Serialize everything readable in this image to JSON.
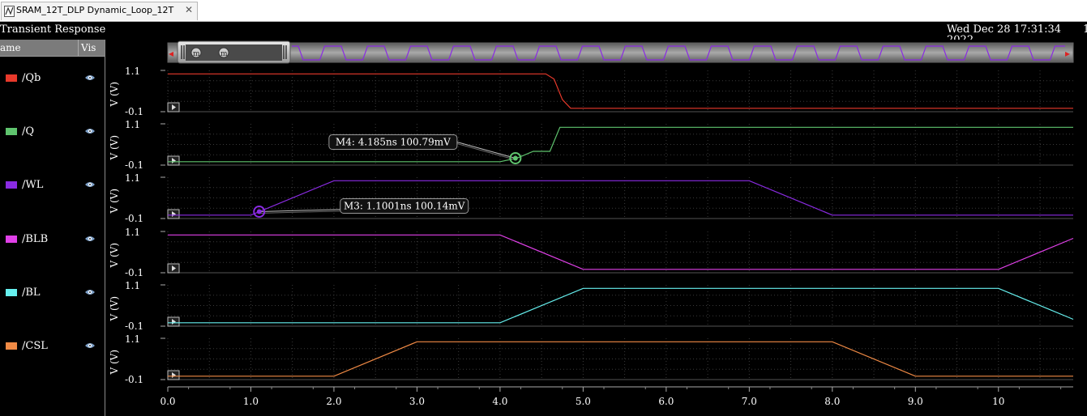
{
  "window": {
    "tab_title": "SRAM_12T_DLP Dynamic_Loop_12T ...",
    "close_glyph": "✕",
    "icon": "waveform-icon"
  },
  "header": {
    "title": "Transient Response",
    "timestamp": "Wed Dec 28 17:31:34",
    "timestamp_line2": "2022",
    "edge_char": "1"
  },
  "legend": {
    "col_name": "ame",
    "col_vis": "Vis",
    "visibility_icon": "eye-icon",
    "signals": [
      {
        "name": "/Qb",
        "color": "#e8392b"
      },
      {
        "name": "/Q",
        "color": "#5fc46e"
      },
      {
        "name": "/WL",
        "color": "#8a2be2"
      },
      {
        "name": "/BLB",
        "color": "#e040e8"
      },
      {
        "name": "/BL",
        "color": "#66f0ef"
      },
      {
        "name": "/CSL",
        "color": "#f08a45"
      }
    ]
  },
  "chart_data": {
    "type": "line",
    "xlim": [
      0,
      10.9
    ],
    "x_ticks": [
      "0.0",
      "1.0",
      "2.0",
      "3.0",
      "4.0",
      "5.0",
      "6.0",
      "7.0",
      "8.0",
      "9.0",
      "10"
    ],
    "ylim": [
      -0.1,
      1.1
    ],
    "y_tick_labels": [
      "1.1",
      "-0.1"
    ],
    "ylabel": "V (V)",
    "grid": true,
    "series": [
      {
        "name": "/Qb",
        "color": "#e8392b",
        "points": [
          [
            0,
            1.0
          ],
          [
            4.55,
            1.0
          ],
          [
            4.65,
            0.85
          ],
          [
            4.75,
            0.25
          ],
          [
            4.85,
            0.0
          ],
          [
            10.9,
            0.0
          ]
        ]
      },
      {
        "name": "/Q",
        "color": "#5fc46e",
        "points": [
          [
            0,
            0.0
          ],
          [
            4.0,
            0.0
          ],
          [
            4.2,
            0.1
          ],
          [
            4.4,
            0.3
          ],
          [
            4.6,
            0.3
          ],
          [
            4.72,
            1.0
          ],
          [
            10.9,
            1.0
          ]
        ]
      },
      {
        "name": "/WL",
        "color": "#8a2be2",
        "points": [
          [
            0,
            0.0
          ],
          [
            1.0,
            0.0
          ],
          [
            2.0,
            1.0
          ],
          [
            7.0,
            1.0
          ],
          [
            8.0,
            0.0
          ],
          [
            10.9,
            0.0
          ]
        ]
      },
      {
        "name": "/BLB",
        "color": "#e040e8",
        "points": [
          [
            0,
            1.0
          ],
          [
            4.0,
            1.0
          ],
          [
            5.0,
            0.0
          ],
          [
            10.0,
            0.0
          ],
          [
            10.9,
            0.9
          ]
        ]
      },
      {
        "name": "/BL",
        "color": "#66f0ef",
        "points": [
          [
            0,
            0.0
          ],
          [
            4.0,
            0.0
          ],
          [
            5.0,
            1.0
          ],
          [
            10.0,
            1.0
          ],
          [
            10.9,
            0.1
          ]
        ]
      },
      {
        "name": "/CSL",
        "color": "#f08a45",
        "points": [
          [
            0,
            0.0
          ],
          [
            2.0,
            0.0
          ],
          [
            3.0,
            1.0
          ],
          [
            8.0,
            1.0
          ],
          [
            9.0,
            0.0
          ],
          [
            10.9,
            0.0
          ]
        ]
      }
    ],
    "markers": [
      {
        "label": "M4: 4.185ns 100.79mV",
        "x": 4.185,
        "y": 0.1008,
        "series": 1,
        "color": "#5fc46e"
      },
      {
        "label": "M3: 1.1001ns 100.14mV",
        "x": 1.1001,
        "y": 0.1001,
        "series": 2,
        "color": "#8a2be2"
      }
    ]
  },
  "scrollbar": {
    "left_arrow": "◂",
    "right_arrow": "▸",
    "handle_glyph": "m"
  }
}
